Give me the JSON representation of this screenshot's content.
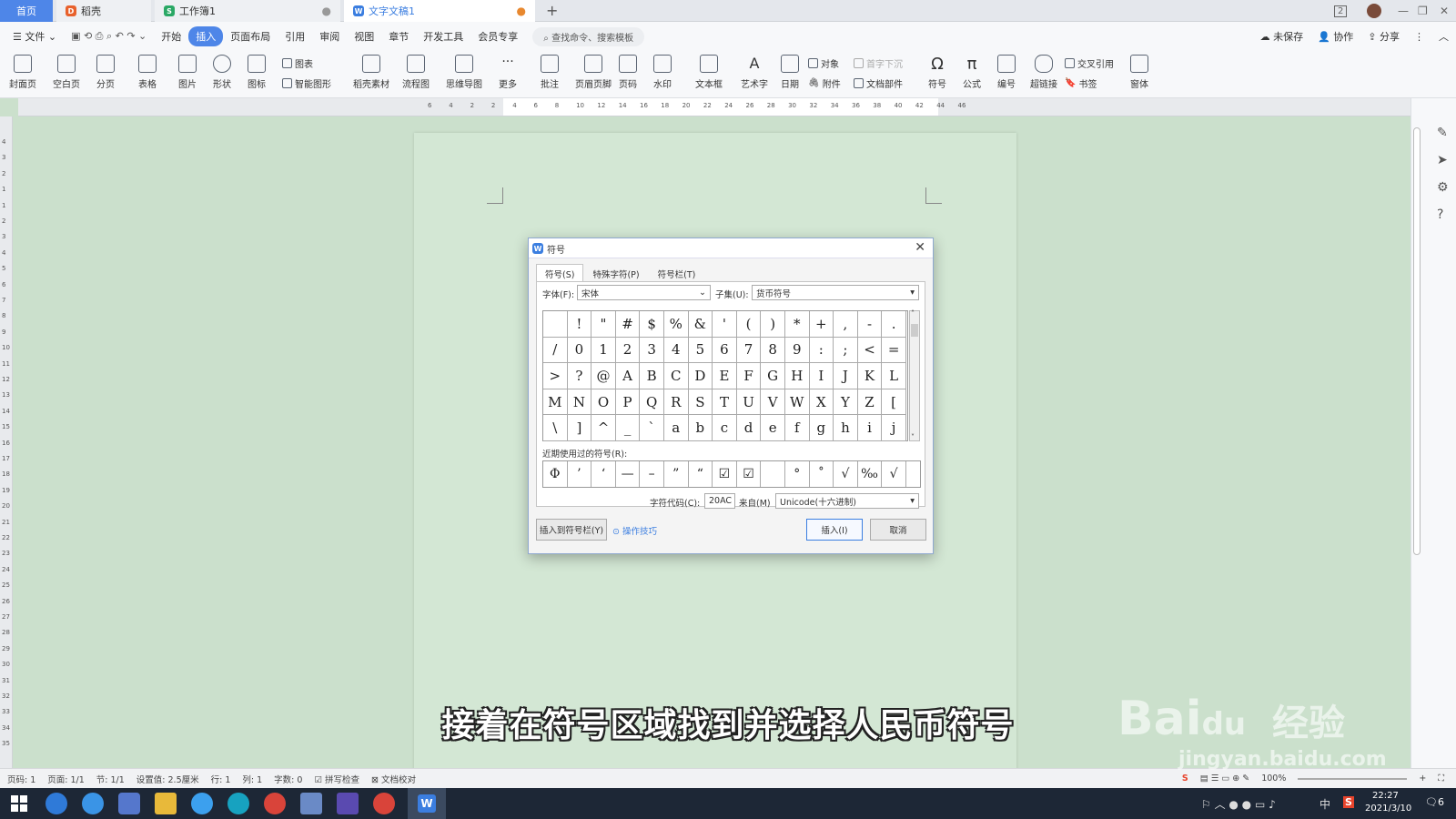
{
  "tabs": {
    "home": "首页",
    "daoke": "稻壳",
    "workbook": "工作簿1",
    "document": "文字文稿1",
    "new_tab": "+"
  },
  "window": {
    "badge": "2",
    "minimize": "—",
    "restore": "❐",
    "close": "✕"
  },
  "menu": {
    "file": "文件",
    "items": [
      "开始",
      "插入",
      "页面布局",
      "引用",
      "审阅",
      "视图",
      "章节",
      "开发工具",
      "会员专享"
    ],
    "active": "插入",
    "search": "查找命令、搜索模板",
    "unsaved": "未保存",
    "collaborate": "协作",
    "share": "分享"
  },
  "ribbon": {
    "cover": "封面页",
    "blank": "空白页",
    "pagebreak": "分页",
    "table": "表格",
    "picture": "图片",
    "shape": "形状",
    "icon": "图标",
    "chart": "图表",
    "smartart": "智能图形",
    "daoke_material": "稻壳素材",
    "flowchart": "流程图",
    "mindmap": "思维导图",
    "more": "更多",
    "comment": "批注",
    "header_footer": "页眉页脚",
    "page_number": "页码",
    "watermark": "水印",
    "textbox": "文本框",
    "wordart": "艺术字",
    "date": "日期",
    "object": "对象",
    "attachment": "附件",
    "dropcap": "首字下沉",
    "doc_parts": "文档部件",
    "symbol": "符号",
    "formula": "公式",
    "numbering": "编号",
    "hyperlink": "超链接",
    "crossref": "交叉引用",
    "bookmark": "书签",
    "window": "窗体"
  },
  "ruler": {
    "h": [
      "6",
      "4",
      "2",
      "2",
      "4",
      "6",
      "8",
      "10",
      "12",
      "14",
      "16",
      "18",
      "20",
      "22",
      "24",
      "26",
      "28",
      "30",
      "32",
      "34",
      "36",
      "38",
      "40",
      "42",
      "44",
      "46"
    ],
    "v": [
      "4",
      "3",
      "2",
      "1",
      "1",
      "2",
      "3",
      "4",
      "5",
      "6",
      "7",
      "8",
      "9",
      "10",
      "11",
      "12",
      "13",
      "14",
      "15",
      "16",
      "17",
      "18",
      "19",
      "20",
      "21",
      "22",
      "23",
      "24",
      "25",
      "26",
      "27",
      "28",
      "29",
      "30",
      "31",
      "32",
      "33",
      "34",
      "35"
    ]
  },
  "dialog": {
    "title": "符号",
    "tabs": [
      "符号(S)",
      "特殊字符(P)",
      "符号栏(T)"
    ],
    "font_label": "字体(F):",
    "font_value": "宋体",
    "subset_label": "子集(U):",
    "subset_value": "货币符号",
    "symbols": [
      " ",
      "!",
      "\"",
      "#",
      "$",
      "%",
      "&",
      "'",
      "(",
      ")",
      "*",
      "+",
      ",",
      "-",
      ".",
      "/",
      "0",
      "1",
      "2",
      "3",
      "4",
      "5",
      "6",
      "7",
      "8",
      "9",
      ":",
      ";",
      "<",
      "=",
      ">",
      "?",
      "@",
      "A",
      "B",
      "C",
      "D",
      "E",
      "F",
      "G",
      "H",
      "I",
      "J",
      "K",
      "L",
      "M",
      "N",
      "O",
      "P",
      "Q",
      "R",
      "S",
      "T",
      "U",
      "V",
      "W",
      "X",
      "Y",
      "Z",
      "[",
      "\\",
      "]",
      "^",
      "_",
      "`",
      "a",
      "b",
      "c",
      "d",
      "e",
      "f",
      "g",
      "h",
      "i",
      "j"
    ],
    "recent_label": "近期使用过的符号(R):",
    "recent": [
      "Φ",
      "’",
      "‘",
      "—",
      "–",
      "”",
      "“",
      "☑",
      "☑",
      " ",
      "°",
      "˚",
      "√",
      "‰",
      "√"
    ],
    "code_label": "字符代码(C):",
    "code_value": "20AC",
    "from_label": "来自(M)",
    "from_value": "Unicode(十六进制)",
    "insert_bar": "插入到符号栏(Y)",
    "tips": "操作技巧",
    "insert": "插入(I)",
    "cancel": "取消"
  },
  "status": {
    "page": "页码: 1",
    "pages": "页面: 1/1",
    "section": "节: 1/1",
    "setting": "设置值: 2.5厘米",
    "row": "行: 1",
    "col": "列: 1",
    "words": "字数: 0",
    "spell": "拼写检查",
    "proof": "文档校对",
    "zoom": "100%"
  },
  "taskbar": {
    "time": "22:27",
    "date": "2021/3/10",
    "ime": "中",
    "notif": "6"
  },
  "caption": "接着在符号区域找到并选择人民币符号",
  "watermark": {
    "brand": "Bai",
    "paw": "du",
    "jy": "经验",
    "url": "jingyan.baidu.com"
  }
}
